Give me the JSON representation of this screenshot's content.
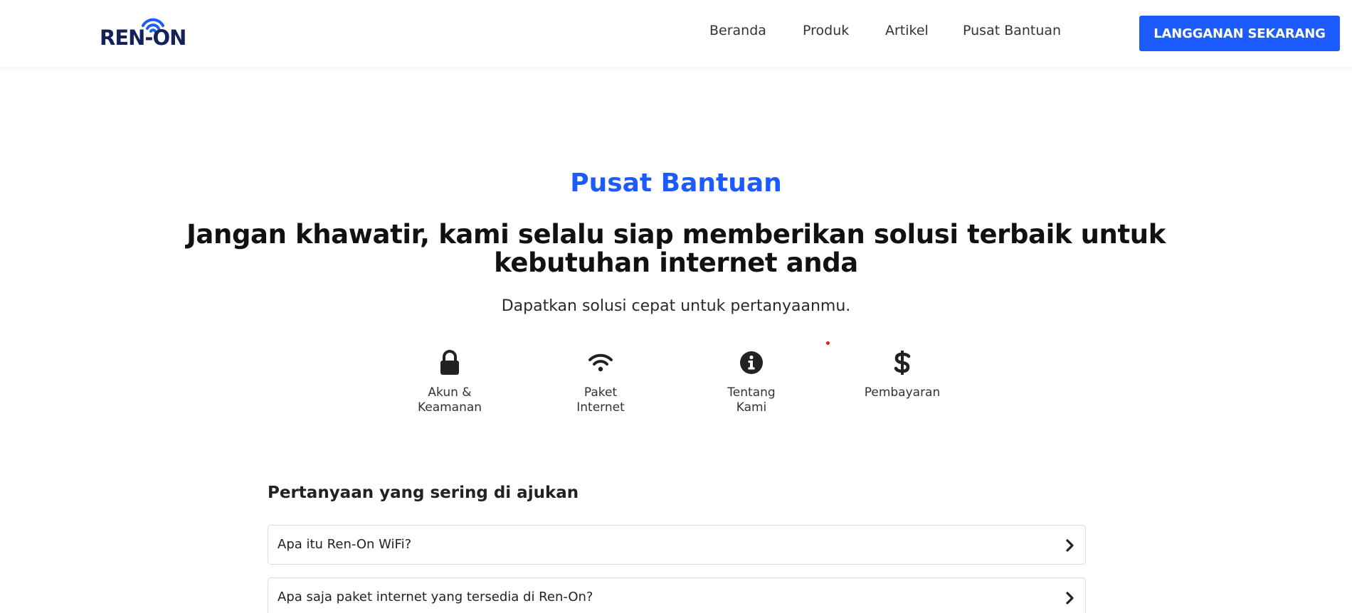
{
  "header": {
    "logo_text": "REN-ON",
    "nav": [
      {
        "label": "Beranda"
      },
      {
        "label": "Produk"
      },
      {
        "label": "Artikel"
      },
      {
        "label": "Pusat Bantuan"
      }
    ],
    "cta_label": "LANGGANAN SEKARANG"
  },
  "hero": {
    "label": "Pusat Bantuan",
    "title": "Jangan khawatir, kami selalu siap memberikan solusi terbaik untuk kebutuhan internet anda",
    "subtitle": "Dapatkan solusi cepat untuk pertanyaanmu."
  },
  "categories": [
    {
      "icon": "lock-icon",
      "label_line1": "Akun &",
      "label_line2": "Keamanan"
    },
    {
      "icon": "wifi-icon",
      "label_line1": "Paket",
      "label_line2": "Internet"
    },
    {
      "icon": "info-icon",
      "label_line1": "Tentang",
      "label_line2": "Kami"
    },
    {
      "icon": "dollar-icon",
      "label_line1": "Pembayaran",
      "label_line2": ""
    }
  ],
  "faq": {
    "title": "Pertanyaan yang sering di ajukan",
    "items": [
      {
        "question": "Apa itu Ren-On WiFi?"
      },
      {
        "question": "Apa saja paket internet yang tersedia di Ren-On?"
      }
    ]
  },
  "colors": {
    "accent": "#1c5cff",
    "logo_dark": "#13235a",
    "text_dark": "#111111"
  }
}
